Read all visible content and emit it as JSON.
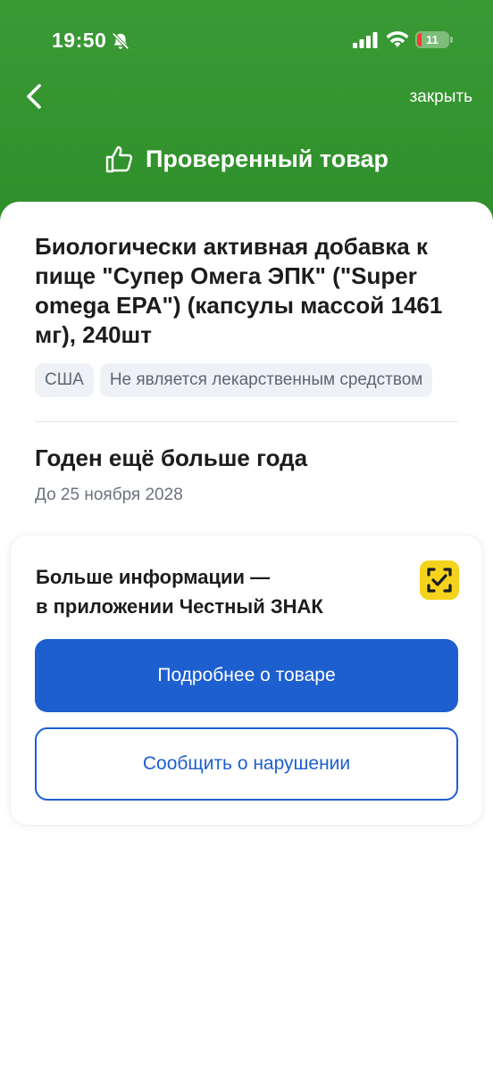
{
  "status_bar": {
    "time": "19:50",
    "battery_level": "11",
    "icons": [
      "bell-slash-icon",
      "signal-icon",
      "wifi-icon",
      "battery-icon"
    ]
  },
  "header": {
    "close_label": "закрыть",
    "verified_title": "Проверенный товар",
    "background_color": "#2e8f2a"
  },
  "product": {
    "title": "Биологически активная добавка к пище \"Супер Омега ЭПК\" (\"Super omega EPA\") (капсулы массой 1461 мг), 240шт",
    "tags": [
      "США",
      "Не является лекарственным средством"
    ],
    "expiry_title": "Годен ещё больше года",
    "expiry_date": "До 25 ноября 2028"
  },
  "info_card": {
    "line1": "Больше информации —",
    "line2": "в приложении Честный ЗНАК",
    "app_icon": "chestny-znak-app-icon",
    "primary_button": "Подробнее о товаре",
    "secondary_button": "Сообщить о нарушении"
  },
  "colors": {
    "accent_blue": "#1d5fcf",
    "header_green": "#2e8f2a",
    "app_icon_yellow": "#f5d31c"
  }
}
